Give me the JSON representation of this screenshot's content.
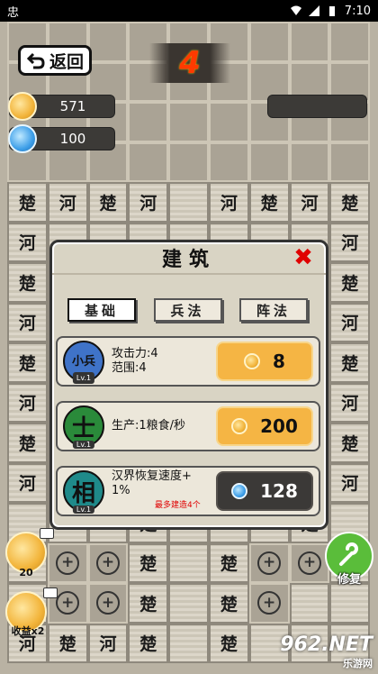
{
  "status_bar": {
    "app_icon": "忠",
    "time": "7:10"
  },
  "hud": {
    "back_label": "返回",
    "level": "4",
    "gold": "571",
    "gems": "100"
  },
  "board": {
    "rows": [
      [
        "",
        "",
        "",
        "",
        "",
        "",
        "",
        "",
        ""
      ],
      [
        "",
        "",
        "",
        "",
        "",
        "",
        "",
        "",
        ""
      ],
      [
        "",
        "",
        "",
        "",
        "",
        "",
        "",
        "",
        ""
      ],
      [
        "",
        "",
        "",
        "",
        "",
        "",
        "",
        "",
        ""
      ],
      [
        "楚",
        "河",
        "楚",
        "河",
        "",
        "河",
        "楚",
        "河",
        "楚"
      ],
      [
        "河",
        "",
        "",
        "",
        "",
        "",
        "",
        "",
        "河"
      ],
      [
        "楚",
        "",
        "",
        "",
        "",
        "",
        "",
        "",
        "楚"
      ],
      [
        "河",
        "",
        "",
        "",
        "",
        "",
        "",
        "",
        "河"
      ],
      [
        "楚",
        "",
        "",
        "",
        "",
        "",
        "",
        "",
        "楚"
      ],
      [
        "河",
        "",
        "",
        "",
        "",
        "",
        "",
        "",
        "河"
      ],
      [
        "楚",
        "",
        "",
        "",
        "",
        "",
        "",
        "",
        "楚"
      ],
      [
        "河",
        "",
        "",
        "",
        "",
        "",
        "",
        "",
        "河"
      ],
      [
        "",
        "",
        "",
        "楚",
        "",
        "",
        "",
        "楚",
        ""
      ],
      [
        "",
        "+",
        "+",
        "楚",
        "",
        "楚",
        "+",
        "+",
        ""
      ],
      [
        "",
        "+",
        "+",
        "楚",
        "",
        "楚",
        "+",
        "",
        ""
      ],
      [
        "河",
        "楚",
        "河",
        "楚",
        "",
        "楚",
        "",
        "",
        ""
      ]
    ]
  },
  "modal": {
    "title": "建筑",
    "tabs": [
      {
        "label": "基础",
        "active": true
      },
      {
        "label": "兵法",
        "active": false
      },
      {
        "label": "阵法",
        "active": false
      }
    ],
    "cards": [
      {
        "badge": "小兵",
        "level": "Lv.1",
        "line1": "攻击力:4",
        "line2": "范围:4",
        "cost": "8",
        "cost_type": "gold",
        "note": ""
      },
      {
        "badge": "士",
        "level": "Lv.1",
        "line1": "生产:1粮食/秒",
        "line2": "",
        "cost": "200",
        "cost_type": "gold",
        "note": ""
      },
      {
        "badge": "相",
        "level": "Lv.1",
        "line1": "汉界恢复速度+",
        "line2": "1%",
        "cost": "128",
        "cost_type": "gem",
        "note": "最多建造4个"
      }
    ]
  },
  "side": {
    "coins_label": "20",
    "income_label": "收益x2",
    "repair_label": "修复"
  },
  "watermark": {
    "main": "962.NET",
    "sub": "乐游网"
  }
}
